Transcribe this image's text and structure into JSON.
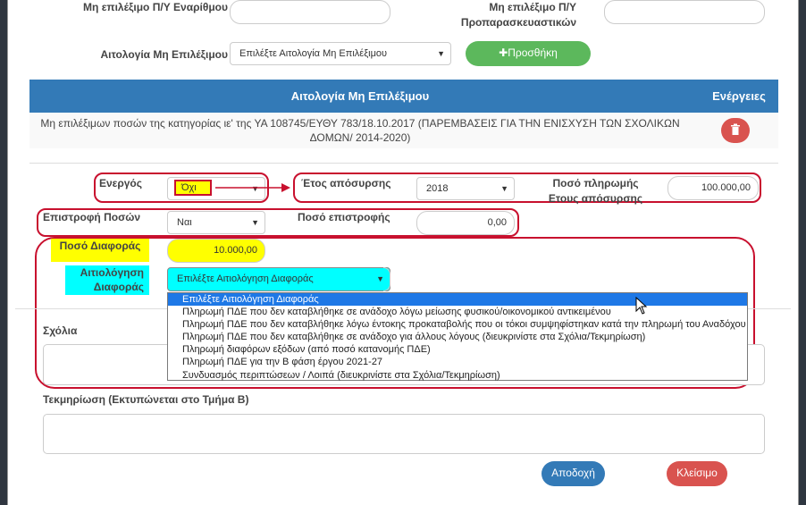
{
  "top_fields": {
    "non_eligible_numbered_label": "Μη επιλέξιμο Π/Υ Εναρίθμου",
    "non_eligible_preparatory_label_line1": "Μη επιλέξιμο Π/Υ",
    "non_eligible_preparatory_label_line2": "Προπαρασκευαστικών",
    "reason_label": "Αιτολογία Μη Επιλέξιμου",
    "reason_select_value": "Επιλέξτε Αιτολογία Μη Επιλέξιμου",
    "add_button_label": "✚Προσθήκη"
  },
  "table": {
    "header_reason": "Αιτολογία Μη Επιλέξιμου",
    "header_actions": "Ενέργειες",
    "header_color": "#337ab7",
    "row_text_line1": "Μη επιλέξιμων ποσών της κατηγορίας ιε' της ΥΑ 108745/ΕΥΘΥ 783/18.10.2017 (ΠΑΡΕΜΒΑΣΕΙΣ ΓΙΑ ΤΗΝ ΕΝΙΣΧΥΣΗ ΤΩΝ ΣΧΟΛΙΚΩΝ",
    "row_text_line2": "ΔΟΜΩΝ/ 2014-2020)",
    "delete_icon": "trash-icon"
  },
  "form": {
    "active_label": "Ενεργός",
    "active_value": "Όχι",
    "withdrawal_year_label": "Έτος απόσυρσης",
    "withdrawal_year_value": "2018",
    "payment_amount_label_line1": "Ποσό πληρωμής",
    "payment_amount_label_line2": "Ετους απόσυρσης",
    "payment_amount_value": "100.000,00",
    "refund_label": "Επιστροφή Ποσών",
    "refund_value": "Ναι",
    "refund_amount_label": "Ποσό επιστροφής",
    "refund_amount_value": "0,00",
    "difference_label": "Ποσό Διαφοράς",
    "difference_value": "10.000,00",
    "difference_reason_label_line1": "Αιτιολόγηση",
    "difference_reason_label_line2": "Διαφοράς",
    "difference_reason_select_value": "Επιλέξτε Αιτιολόγηση Διαφοράς",
    "highlight_yellow": "#ffff00",
    "highlight_cyan": "#00ffff"
  },
  "dropdown_options": [
    "Επιλέξτε Αιτιολόγηση Διαφοράς",
    "Πληρωμή ΠΔΕ που δεν καταβλήθηκε σε ανάδοχο λόγω μείωσης φυσικού/οικονομικού αντικειμένου",
    "Πληρωμή ΠΔΕ που δεν καταβλήθηκε λόγω έντοκης προκαταβολής που οι τόκοι συμψηφίστηκαν κατά την πληρωμή του Αναδόχου",
    "Πληρωμή ΠΔΕ που δεν καταβλήθηκε σε ανάδοχο για άλλους λόγους (διευκρινίστε στα Σχόλια/Τεκμηρίωση)",
    "Πληρωμή διαφόρων εξόδων (από ποσό κατανομής ΠΔΕ)",
    "Πληρωμή ΠΔΕ για την Β φάση έργου 2021-27",
    "Συνδυασμός περιπτώσεων / Λοιπά (διευκρινίστε στα Σχόλια/Τεκμηρίωση)"
  ],
  "comments_label": "Σχόλια",
  "documentation_label": "Τεκμηρίωση (Εκτυπώνεται στο Τμήμα Β)",
  "footer": {
    "accept_label": "Αποδοχή",
    "close_label": "Κλείσιμο",
    "accept_color": "#337ab7",
    "close_color": "#d9534f"
  }
}
